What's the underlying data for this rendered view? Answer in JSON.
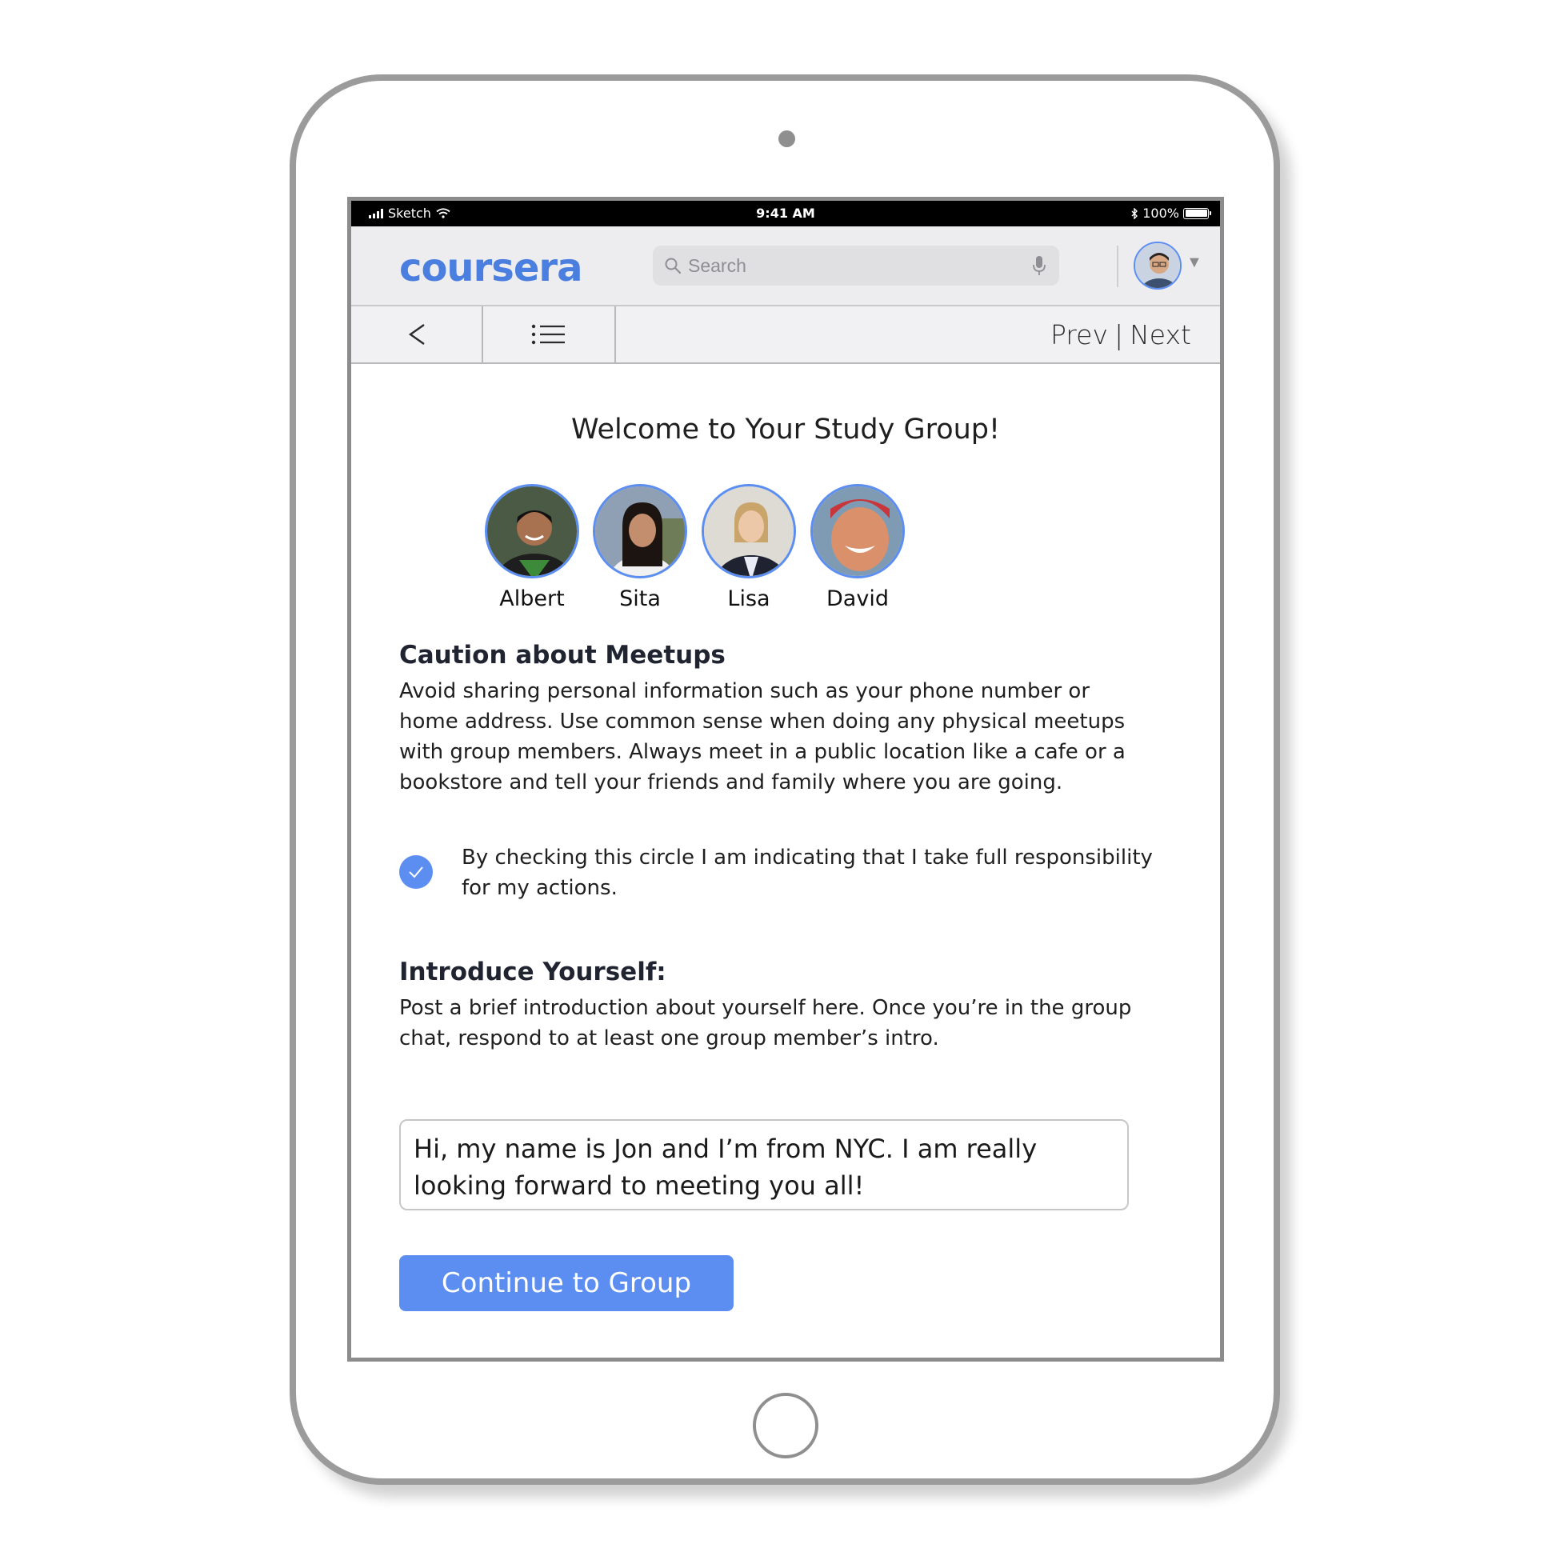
{
  "status_bar": {
    "carrier": "Sketch",
    "time": "9:41 AM",
    "battery": "100%"
  },
  "header": {
    "logo_text": "coursera",
    "search": {
      "placeholder": "Search",
      "value": ""
    },
    "icons": [
      "search-icon",
      "microphone-icon",
      "user-avatar",
      "caret-down-icon"
    ]
  },
  "nav": {
    "back_label": "<",
    "prev_label": "Prev",
    "separator": "|",
    "next_label": "Next"
  },
  "main": {
    "title": "Welcome to Your Study Group!",
    "members": [
      {
        "name": "Albert"
      },
      {
        "name": "Sita"
      },
      {
        "name": "Lisa"
      },
      {
        "name": "David"
      }
    ],
    "caution": {
      "heading": "Caution about Meetups",
      "text": "Avoid sharing personal information such as your phone number or home address. Use common sense when doing any physical meetups with group members. Always meet in a public location like a cafe or a bookstore and tell your friends and family where you are going.",
      "checkbox_checked": true,
      "checkbox_label": "By checking this circle I am indicating that I take full responsibility for my actions."
    },
    "intro": {
      "heading": "Introduce Yourself:",
      "text": "Post a brief introduction about yourself here. Once you’re in the group chat, respond to at least one group member’s intro.",
      "input_value": "Hi, my name is Jon and I’m from NYC. I am really looking forward to meeting you all!"
    },
    "continue_label": "Continue to Group"
  },
  "colors": {
    "accent": "#5c8ef2",
    "logo": "#4a7fe0",
    "status_bar": "#000000",
    "header_bg": "#ededf0"
  }
}
